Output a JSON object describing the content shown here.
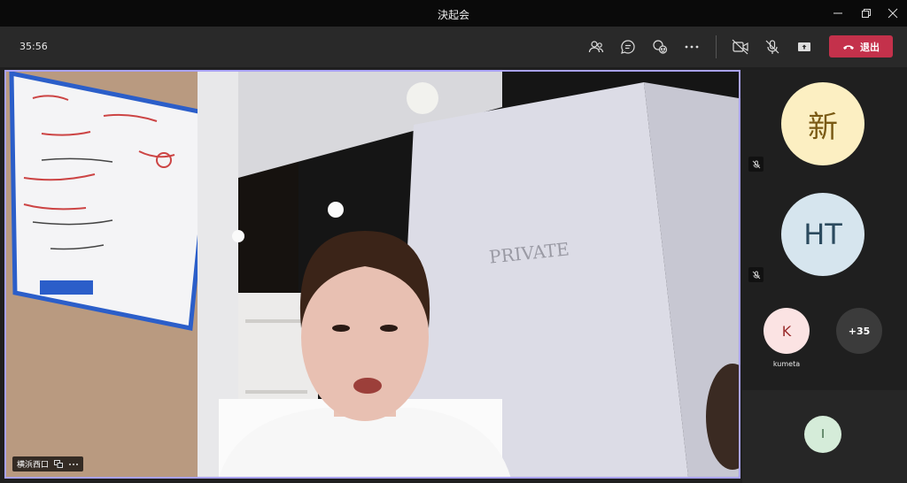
{
  "window": {
    "title": "決起会"
  },
  "toolbar": {
    "timer": "35:56",
    "leave_label": "退出",
    "icons": [
      "participants-icon",
      "chat-icon",
      "reactions-icon",
      "more-icon",
      "camera-off-icon",
      "mic-off-icon",
      "share-icon"
    ]
  },
  "main_video": {
    "speaker_name": "横浜西口",
    "room_sign": "PRIVATE"
  },
  "participants": [
    {
      "initials": "新",
      "muted": true,
      "bg": "#fcefc2",
      "fg": "#7a5a14"
    },
    {
      "initials": "HT",
      "muted": true,
      "bg": "#d6e5ee",
      "fg": "#2b4a5e"
    },
    {
      "initials": "K",
      "name": "kumeta",
      "bg": "#fbe3e3",
      "fg": "#9a2c2c"
    },
    {
      "initials": "+35",
      "bg": "#3b3b3b",
      "fg": "#ffffff"
    },
    {
      "initials": "I",
      "bg": "#d5ecd9",
      "fg": "#2d5a37"
    }
  ],
  "colors": {
    "accent_border": "#a9a2f5",
    "leave_red": "#c4314b"
  }
}
